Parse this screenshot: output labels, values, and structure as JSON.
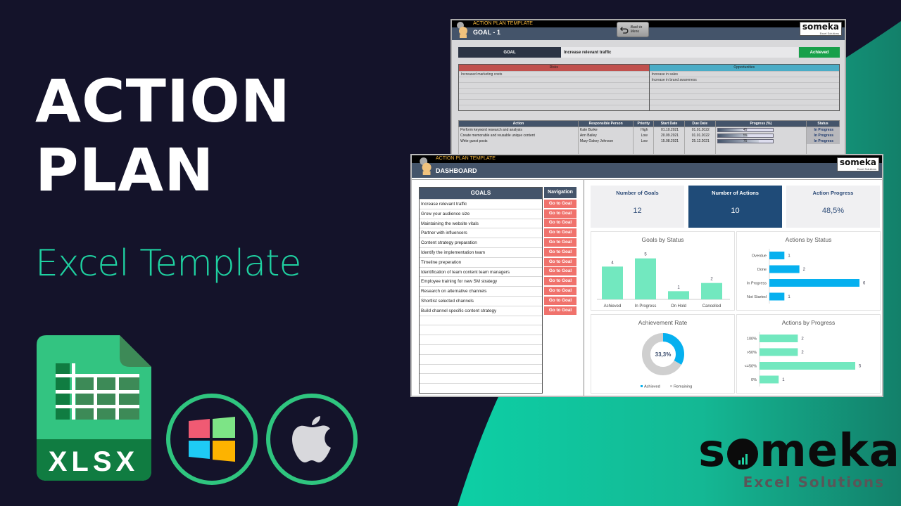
{
  "hero": {
    "title_line1": "ACTION",
    "title_line2": "PLAN",
    "subtitle": "Excel Template"
  },
  "badges": {
    "file_type": "XLSX",
    "platform_icons": [
      "windows-icon",
      "apple-icon"
    ]
  },
  "brand": {
    "name_prefix": "s",
    "name_suffix": "meka",
    "tagline": "Excel Solutions"
  },
  "colors": {
    "background": "#14132a",
    "accent": "#1fd1a1",
    "header": "#44546a",
    "button": "#f0726c",
    "chart_green": "#72e8bf",
    "chart_blue": "#06b0ef"
  },
  "goal_sheet": {
    "app_title": "ACTION PLAN TEMPLATE",
    "sheet_title": "GOAL - 1",
    "back_button": "Back to Menu",
    "logo_name": "someka",
    "logo_sub": "Excel Solutions",
    "goal_label": "GOAL",
    "goal_value": "Increase relevant traffic",
    "goal_status": "Achieved",
    "risks_header": "Risks",
    "opportunities_header": "Opportunities",
    "risks": [
      "Increased marketing costs",
      "",
      "",
      "",
      "",
      "",
      ""
    ],
    "opportunities": [
      "Increase in sales",
      "Increase in brand awareness",
      "",
      "",
      "",
      "",
      ""
    ],
    "actions_headers": [
      "Action",
      "Responsible Person",
      "Priority",
      "Start Date",
      "Due Date",
      "Progress (%)",
      "Status"
    ],
    "actions": [
      {
        "action": "Perform keyword research and analysis",
        "person": "Kate Burke",
        "priority": "High",
        "start": "01.10.2021",
        "due": "01.01.2022",
        "progress": 45,
        "progress_label": "45",
        "status": "In Progress"
      },
      {
        "action": "Create memorable and reusable unique content",
        "person": "Ann Bailey",
        "priority": "Low",
        "start": "20.09.2021",
        "due": "01.01.2022",
        "progress": 55,
        "progress_label": "55",
        "status": "In Progress"
      },
      {
        "action": "Write guest posts",
        "person": "Mary Oakey Johnson",
        "priority": "Low",
        "start": "15.08.2021",
        "due": "25.12.2021",
        "progress": 75,
        "progress_label": "75",
        "status": "In Progress"
      }
    ]
  },
  "dashboard": {
    "app_title": "ACTION PLAN TEMPLATE",
    "sheet_title": "DASHBOARD",
    "logo_name": "someka",
    "logo_sub": "Excel Solutions",
    "goals_header": "GOALS",
    "navigation_header": "Navigation",
    "goto_label": "Go to Goal",
    "goals": [
      "Increase relevant traffic",
      "Grow your audience size",
      "Maintaining the website vitals",
      "Partner with influencers",
      "Content strategy preparation",
      "Identify the implementation team",
      "Timeline preperation",
      "Identification of team content team managers",
      "Employee training for new SM strategy",
      "Research on alternative channels",
      "Shortlist selected channels",
      "Build channel specific content strategy",
      "",
      "",
      "",
      "",
      "",
      "",
      "",
      ""
    ],
    "kpis": [
      {
        "title": "Number of Goals",
        "value": "12"
      },
      {
        "title": "Number of Actions",
        "value": "10"
      },
      {
        "title": "Action Progress",
        "value": "48,5%"
      }
    ]
  },
  "chart_data": [
    {
      "type": "bar",
      "title": "Goals by Status",
      "categories": [
        "Achieved",
        "In Progress",
        "On Hold",
        "Cancelled"
      ],
      "values": [
        4,
        5,
        1,
        2
      ],
      "orientation": "vertical",
      "data_labels": true,
      "grid": false
    },
    {
      "type": "bar",
      "title": "Actions by Status",
      "categories": [
        "Overdue",
        "Done",
        "In Progress",
        "Not Started"
      ],
      "values": [
        1,
        2,
        6,
        1
      ],
      "orientation": "horizontal",
      "data_labels": true,
      "grid": false
    },
    {
      "type": "pie",
      "title": "Achievement Rate",
      "categories": [
        "Achieved",
        "Remaining"
      ],
      "values": [
        33.3,
        66.7
      ],
      "center_label": "33,3%",
      "donut": true,
      "legend": "bottom"
    },
    {
      "type": "bar",
      "title": "Actions by Progress",
      "categories": [
        "100%",
        ">50%",
        "<=50%",
        "0%"
      ],
      "values": [
        2,
        2,
        5,
        1
      ],
      "orientation": "horizontal",
      "data_labels": true,
      "grid": false
    }
  ]
}
